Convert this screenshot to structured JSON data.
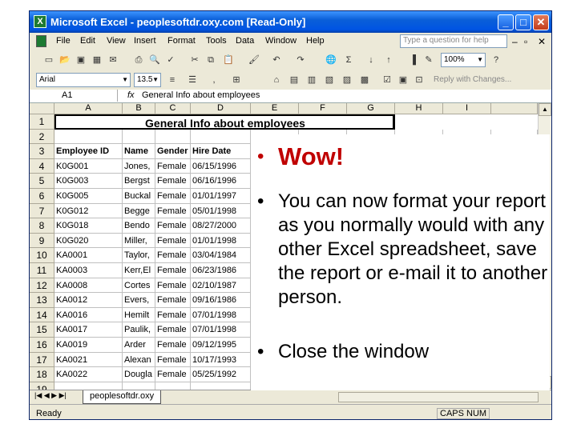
{
  "window": {
    "title": "Microsoft Excel - peoplesoftdr.oxy.com  [Read-Only]"
  },
  "menu": {
    "items": [
      "File",
      "Edit",
      "View",
      "Insert",
      "Format",
      "Tools",
      "Data",
      "Window",
      "Help"
    ],
    "question_placeholder": "Type a question for help"
  },
  "formatting": {
    "font": "Arial",
    "size": "13.5",
    "zoom": "100%",
    "reply": "Reply with Changes..."
  },
  "formula_bar": {
    "cell_ref": "A1",
    "fx": "fx",
    "content": "General Info about employees"
  },
  "sheet": {
    "columns": [
      "A",
      "B",
      "C",
      "D",
      "E",
      "F",
      "G",
      "H",
      "I"
    ],
    "title": "General Info about employees",
    "headers": [
      "Employee ID",
      "Name",
      "Gender",
      "Hire Date"
    ],
    "rows": [
      [
        "K0G001",
        "Jones,",
        "Female",
        "06/15/1996"
      ],
      [
        "K0G003",
        "Bergst",
        "Female",
        "06/16/1996"
      ],
      [
        "K0G005",
        "Buckal",
        "Female",
        "01/01/1997"
      ],
      [
        "K0G012",
        "Begge",
        "Female",
        "05/01/1998"
      ],
      [
        "K0G018",
        "Bendo",
        "Female",
        "08/27/2000"
      ],
      [
        "K0G020",
        "Miller,",
        "Female",
        "01/01/1998"
      ],
      [
        "KA0001",
        "Taylor,",
        "Female",
        "03/04/1984"
      ],
      [
        "KA0003",
        "Kerr,El",
        "Female",
        "06/23/1986"
      ],
      [
        "KA0008",
        "Cortes",
        "Female",
        "02/10/1987"
      ],
      [
        "KA0012",
        "Evers,",
        "Female",
        "09/16/1986"
      ],
      [
        "KA0016",
        "Hemilt",
        "Female",
        "07/01/1998"
      ],
      [
        "KA0017",
        "Paulik,",
        "Female",
        "07/01/1998"
      ],
      [
        "KA0019",
        "Arder",
        "Female",
        "09/12/1995"
      ],
      [
        "KA0021",
        "Alexan",
        "Female",
        "10/17/1993"
      ],
      [
        "KA0022",
        "Dougla",
        "Female",
        "05/25/1992"
      ]
    ],
    "tab_name": "peoplesoftdr.oxy"
  },
  "status": {
    "left": "Ready",
    "right": "CAPS NUM"
  },
  "slide": {
    "heading": "Wow!",
    "bullet1": "You can now format your report as you normally would with any other Excel spreadsheet, save the report or e-mail it to another person.",
    "bullet2": "Close the window"
  }
}
